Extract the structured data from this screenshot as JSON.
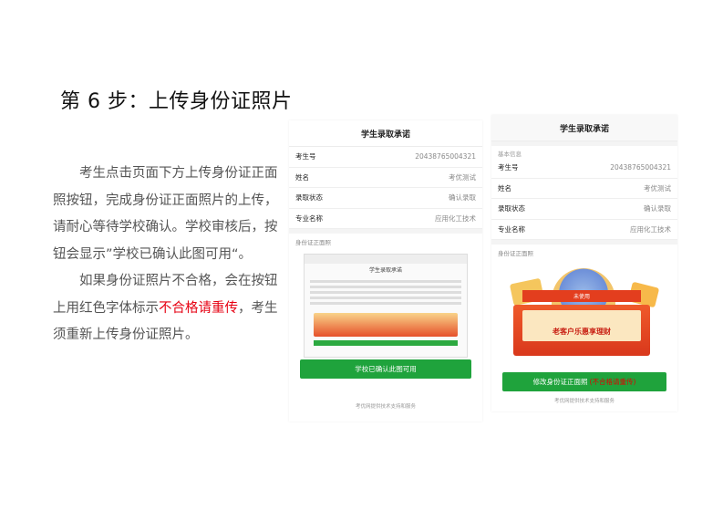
{
  "heading": "第 6 步：上传身份证照片",
  "instructions": {
    "p1": "考生点击页面下方上传身份证正面照按钮，完成身份证正面照片的上传，请耐心等待学校确认。学校审核后，按钮会显示”学校已确认此图可用“。",
    "p2_before": "如果身份证照片不合格，会在按钮上用红色字体标示",
    "p2_red": "不合格请重传",
    "p2_after": "，考生须重新上传身份证照片。"
  },
  "phone1": {
    "title": "学生录取承诺",
    "rows": [
      {
        "label": "考生号",
        "value": "20438765004321"
      },
      {
        "label": "姓名",
        "value": "考优测试"
      },
      {
        "label": "录取状态",
        "value": "确认录取"
      },
      {
        "label": "专业名称",
        "value": "应用化工技术"
      }
    ],
    "photo_label": "身份证正面照",
    "thumb_title": "学生录取承诺",
    "confirm_button": "学校已确认此图可用",
    "footer": "考优网提供技术支持和服务"
  },
  "phone2": {
    "title": "学生录取承诺",
    "section_label": "基本信息",
    "rows": [
      {
        "label": "考生号",
        "value": "20438765004321"
      },
      {
        "label": "姓名",
        "value": "考优测试"
      },
      {
        "label": "录取状态",
        "value": "确认录取"
      },
      {
        "label": "专业名称",
        "value": "应用化工技术"
      }
    ],
    "photo_label": "身份证正面照",
    "promo_title": "老客户乐惠享理财",
    "promo_tag": "未使用",
    "modify_button": "修改身份证正面照",
    "modify_warning": "(不合格请重传)",
    "footer": "考优网提供技术支持和服务"
  },
  "colors": {
    "green": "#1fa33c",
    "red": "#e60012"
  }
}
